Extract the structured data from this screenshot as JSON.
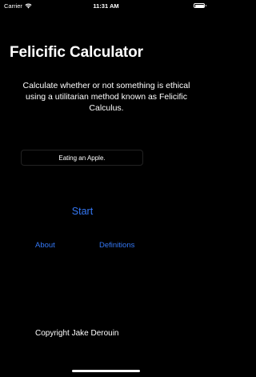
{
  "status_bar": {
    "carrier": "Carrier",
    "time": "11:31 AM",
    "wifi_icon": "wifi-icon",
    "battery_icon": "battery-icon",
    "battery_level": 1.0
  },
  "app": {
    "title": "Felicific Calculator",
    "description": "Calculate whether or not something is ethical using a utilitarian method known as Felicific Calculus."
  },
  "input": {
    "value": "Eating an Apple."
  },
  "buttons": {
    "start": "Start",
    "about": "About",
    "definitions": "Definitions"
  },
  "footer": {
    "copyright": "Copyright Jake Derouin"
  },
  "colors": {
    "background": "#000000",
    "text": "#ffffff",
    "accent": "#3478f6"
  }
}
